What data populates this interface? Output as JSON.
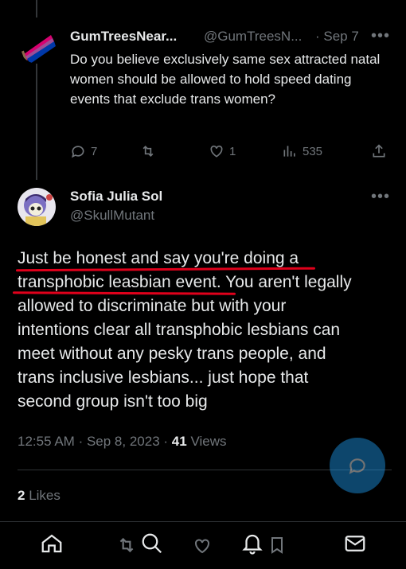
{
  "parent_tweet": {
    "display_name": "GumTreesNear...",
    "handle": "@GumTreesN...",
    "date": "· Sep 7",
    "more": "•••",
    "text": "Do you believe exclusively same sex attracted natal women should be allowed to hold speed dating events that exclude trans women?",
    "stats": {
      "replies": "7",
      "retweets": "",
      "likes": "1",
      "views": "535"
    }
  },
  "main_tweet": {
    "display_name": "Sofia Julia Sol",
    "handle": "@SkullMutant",
    "more": "•••",
    "text_lines": [
      "Just be honest and say you're doing a",
      "transphobic leasbian event. You aren't legally",
      "allowed to discriminate but with your",
      "intentions clear all transphobic lesbians can",
      "meet without any pesky trans people, and",
      "trans inclusive lesbians... just hope that",
      "second group isn't too big"
    ],
    "time": "12:55 AM",
    "date": "Sep 8, 2023",
    "views_count": "41",
    "views_label": "Views",
    "likes_count": "2",
    "likes_label": "Likes"
  },
  "colors": {
    "accent": "#1d9bf0",
    "underline": "#e0001b",
    "muted": "#71767b"
  },
  "icons": [
    "reply-icon",
    "retweet-icon",
    "like-icon",
    "views-icon",
    "share-icon",
    "home-icon",
    "search-icon",
    "notifications-icon",
    "bookmark-icon",
    "messages-icon",
    "compose-icon"
  ]
}
